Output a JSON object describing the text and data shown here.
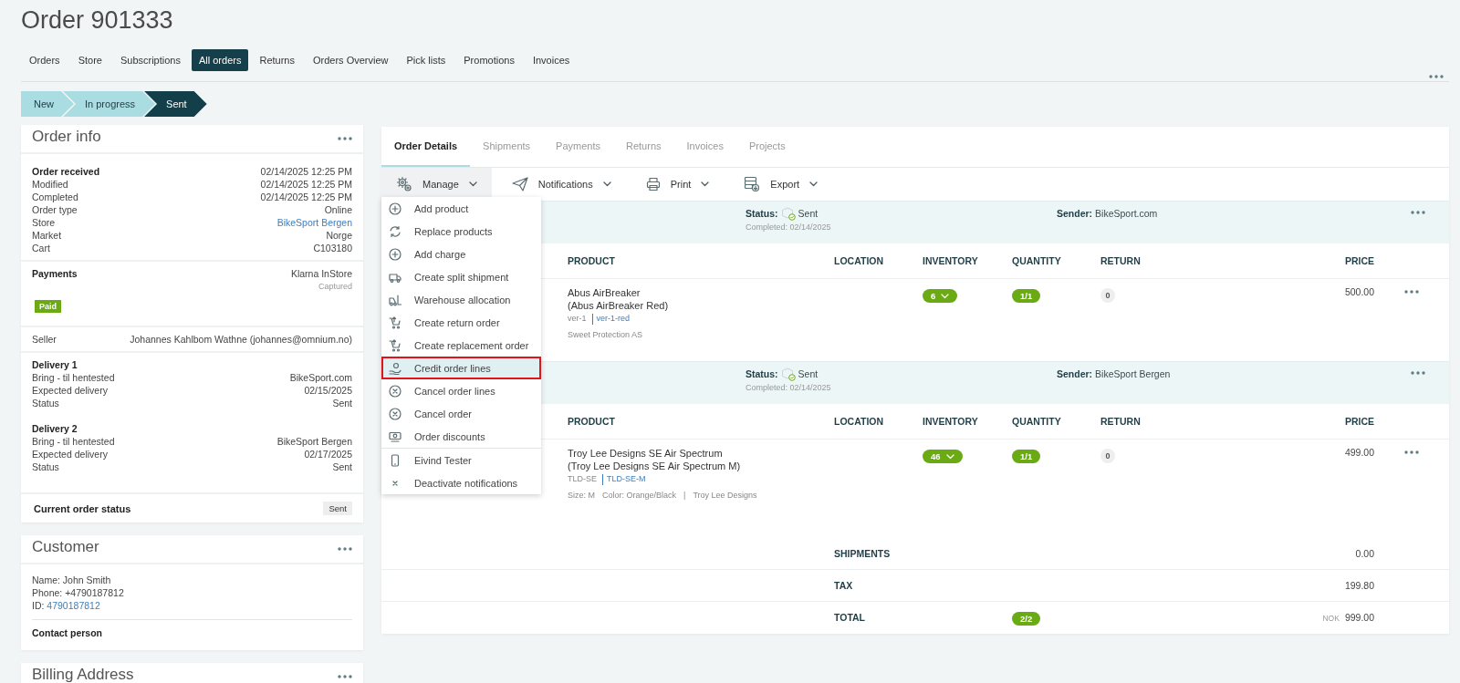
{
  "page_title": "Order 901333",
  "nav_tabs": [
    {
      "label": "Orders",
      "selected": false
    },
    {
      "label": "Store",
      "selected": false
    },
    {
      "label": "Subscriptions",
      "selected": false
    },
    {
      "label": "All orders",
      "selected": true
    },
    {
      "label": "Returns",
      "selected": false
    },
    {
      "label": "Orders Overview",
      "selected": false
    },
    {
      "label": "Pick lists",
      "selected": false
    },
    {
      "label": "Promotions",
      "selected": false
    },
    {
      "label": "Invoices",
      "selected": false
    }
  ],
  "progress_steps": [
    {
      "label": "New",
      "current": false
    },
    {
      "label": "In progress",
      "current": false
    },
    {
      "label": "Sent",
      "current": true
    }
  ],
  "order_info": {
    "title": "Order info",
    "sections": [
      {
        "kind": "rows",
        "rows": [
          {
            "label": "Order received",
            "value": "02/14/2025 12:25 PM",
            "kind": "heading"
          },
          {
            "label": "Modified",
            "value": "02/14/2025 12:25 PM",
            "kind": "plain"
          },
          {
            "label": "Completed",
            "value": "02/14/2025 12:25 PM",
            "kind": "plain"
          },
          {
            "label": "Order type",
            "value": "Online",
            "kind": "plain"
          },
          {
            "label": "Store",
            "value": "BikeSport Bergen",
            "kind": "link"
          },
          {
            "label": "Market",
            "value": "Norge",
            "kind": "plain"
          },
          {
            "label": "Cart",
            "value": "C103180",
            "kind": "plain"
          }
        ]
      },
      {
        "kind": "payment",
        "label": "Payments",
        "method": "Klarna InStore",
        "note": "Captured",
        "badge": "Paid"
      },
      {
        "kind": "rows",
        "rows": [
          {
            "label": "Seller",
            "value": "Johannes Kahlbom Wathne (johannes@omnium.no)",
            "kind": "plain"
          }
        ]
      },
      {
        "kind": "deliveries",
        "deliveries": [
          {
            "title": "Delivery 1",
            "rows": [
              {
                "label": "Bring - til hentested",
                "value": "BikeSport.com",
                "kind": "plain"
              },
              {
                "label": "Expected delivery",
                "value": "02/15/2025",
                "kind": "plain"
              },
              {
                "label": "Status",
                "value": "Sent",
                "kind": "plain"
              }
            ]
          },
          {
            "title": "Delivery 2",
            "rows": [
              {
                "label": "Bring - til hentested",
                "value": "BikeSport Bergen",
                "kind": "plain"
              },
              {
                "label": "Expected delivery",
                "value": "02/17/2025",
                "kind": "plain"
              },
              {
                "label": "Status",
                "value": "Sent",
                "kind": "plain"
              }
            ]
          }
        ]
      },
      {
        "kind": "status",
        "label": "Current order status",
        "value": "Sent"
      }
    ]
  },
  "customer": {
    "title": "Customer",
    "lines": [
      {
        "kind": "text",
        "text": "Name: John Smith"
      },
      {
        "kind": "text",
        "text": "Phone: +4790187812"
      },
      {
        "kind": "link",
        "label": "ID:",
        "link": "4790187812"
      }
    ],
    "contact_title": "Contact person"
  },
  "billing_address": {
    "title": "Billing Address"
  },
  "details": {
    "tabs": [
      {
        "label": "Order Details",
        "selected": true
      },
      {
        "label": "Shipments",
        "selected": false
      },
      {
        "label": "Payments",
        "selected": false
      },
      {
        "label": "Returns",
        "selected": false
      },
      {
        "label": "Invoices",
        "selected": false
      },
      {
        "label": "Projects",
        "selected": false
      }
    ],
    "toolbar": [
      {
        "label": "Manage",
        "open": true
      },
      {
        "label": "Notifications",
        "open": false
      },
      {
        "label": "Print",
        "open": false
      },
      {
        "label": "Export",
        "open": false
      }
    ],
    "menu": {
      "groups": [
        [
          {
            "label": "Add product",
            "selected": false
          },
          {
            "label": "Replace products",
            "selected": false
          },
          {
            "label": "Add charge",
            "selected": false
          },
          {
            "label": "Create split shipment",
            "selected": false
          },
          {
            "label": "Warehouse allocation",
            "selected": false
          },
          {
            "label": "Create return order",
            "selected": false
          },
          {
            "label": "Create replacement order",
            "selected": false
          },
          {
            "label": "Credit order lines",
            "selected": true
          },
          {
            "label": "Cancel order lines",
            "selected": false
          },
          {
            "label": "Cancel order",
            "selected": false
          },
          {
            "label": "Order discounts",
            "selected": false
          }
        ],
        [
          {
            "label": "Eivind Tester",
            "selected": false
          },
          {
            "label": "Deactivate notifications",
            "selected": false
          }
        ]
      ]
    },
    "shipments": [
      {
        "status_label": "Status:",
        "status": "Sent",
        "completed_label": "Completed:",
        "completed": "02/14/2025",
        "sender_label": "Sender:",
        "sender": "BikeSport.com",
        "columns": [
          "PRODUCT",
          "LOCATION",
          "INVENTORY",
          "QUANTITY",
          "RETURN",
          "PRICE"
        ],
        "lines": [
          {
            "name": "Abus AirBreaker",
            "variant": "(Abus AirBreaker Red)",
            "sku": "ver-1",
            "variant_sku": "ver-1-red",
            "details": [
              "Sweet Protection AS"
            ],
            "inventory": "6",
            "quantity": "1/1",
            "return": "0",
            "price": "500.00"
          }
        ]
      },
      {
        "status_label": "Status:",
        "status": "Sent",
        "completed_label": "Completed:",
        "completed": "02/14/2025",
        "sender_label": "Sender:",
        "sender": "BikeSport Bergen",
        "columns": [
          "PRODUCT",
          "LOCATION",
          "INVENTORY",
          "QUANTITY",
          "RETURN",
          "PRICE"
        ],
        "lines": [
          {
            "name": "Troy Lee Designs SE Air Spectrum",
            "variant": "(Troy Lee Designs SE Air Spectrum M)",
            "sku": "TLD-SE",
            "variant_sku": "TLD-SE-M",
            "details": [
              "Size: M",
              "Color: Orange/Black",
              "|",
              "Troy Lee Designs"
            ],
            "inventory": "46",
            "quantity": "1/1",
            "return": "0",
            "price": "499.00"
          }
        ]
      }
    ],
    "totals": [
      {
        "label": "SHIPMENTS",
        "value": "0.00"
      },
      {
        "label": "TAX",
        "value": "199.80"
      },
      {
        "label": "TOTAL",
        "quantity": "2/2",
        "currency": "NOK",
        "value": "999.00"
      }
    ]
  }
}
